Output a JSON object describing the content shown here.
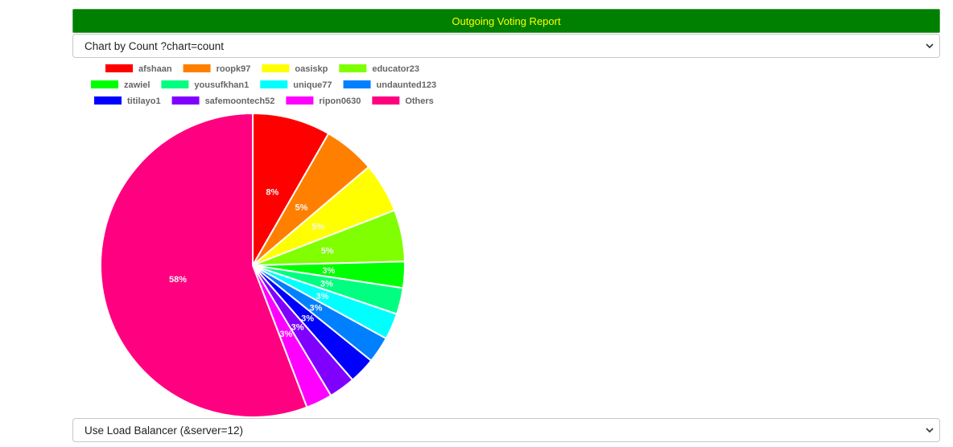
{
  "header": {
    "title": "Outgoing Voting Report"
  },
  "chart_select": {
    "value": "Chart by Count ?chart=count"
  },
  "server_select": {
    "value": "Use Load Balancer (&server=12)"
  },
  "chart_data": {
    "type": "pie",
    "labels": [
      "afshaan",
      "roopk97",
      "oasiskp",
      "educator23",
      "zawiel",
      "yousufkhan1",
      "unique77",
      "undaunted123",
      "titilayo1",
      "safemoontech52",
      "ripon0630",
      "Others"
    ],
    "values": [
      8.3,
      5.5,
      5.3,
      5.5,
      2.8,
      2.8,
      2.8,
      2.8,
      2.8,
      2.8,
      2.8,
      55.8
    ],
    "display_labels": [
      "8%",
      "5%",
      "5%",
      "5%",
      "3%",
      "3%",
      "3%",
      "3%",
      "3%",
      "3%",
      "3%",
      "58%"
    ],
    "colors": [
      "#ff0000",
      "#ff8000",
      "#ffff00",
      "#80ff00",
      "#00ff00",
      "#00ff80",
      "#00ffff",
      "#0080ff",
      "#0000ff",
      "#8000ff",
      "#ff00ff",
      "#ff0080"
    ],
    "legend_position": "top-left",
    "start_angle": "12 o'clock, clockwise"
  }
}
